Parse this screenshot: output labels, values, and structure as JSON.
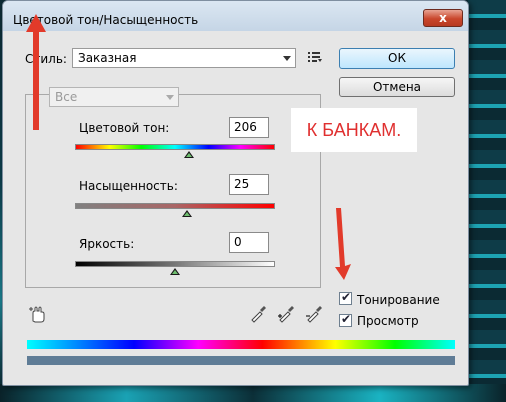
{
  "window": {
    "title": "Цветовой тон/Насыщенность",
    "close_label": "x"
  },
  "style": {
    "label": "Стиль:",
    "value": "Заказная"
  },
  "buttons": {
    "ok": "ОК",
    "cancel": "Отмена"
  },
  "channel": {
    "value": "Все"
  },
  "hue": {
    "label": "Цветовой тон:",
    "value": "206",
    "slider_fraction": 0.57
  },
  "saturation": {
    "label": "Насыщенность:",
    "value": "25",
    "slider_fraction": 0.56
  },
  "lightness": {
    "label": "Яркость:",
    "value": "0",
    "slider_fraction": 0.5
  },
  "options": {
    "colorize_label": "Тонирование",
    "preview_label": "Просмотр",
    "colorize_checked": true,
    "preview_checked": true
  },
  "annotation": {
    "text": "К БАНКАМ.",
    "color": "#e03030"
  },
  "icons": [
    "menu-list-icon",
    "hand-target-icon",
    "eyedropper-icon",
    "eyedropper-plus-icon",
    "eyedropper-minus-icon",
    "arrow-up-annotation",
    "arrow-down-annotation"
  ]
}
